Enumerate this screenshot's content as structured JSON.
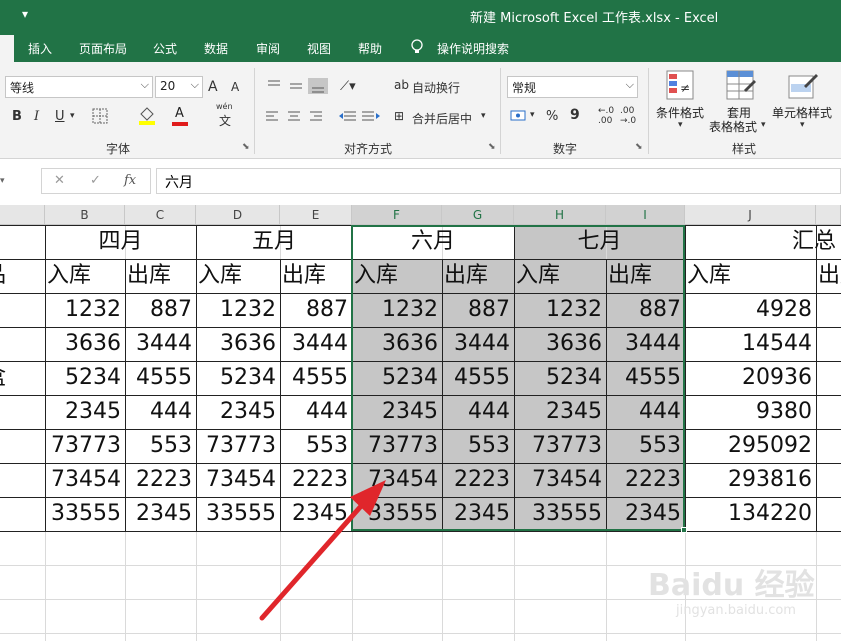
{
  "titlebar": {
    "qa_arrow": "▾",
    "title": "新建 Microsoft Excel 工作表.xlsx  -  Excel"
  },
  "menu": [
    "插入",
    "页面布局",
    "公式",
    "数据",
    "审阅",
    "视图",
    "帮助",
    "操作说明搜索"
  ],
  "ribbon": {
    "font_name": "等线",
    "font_size": "20",
    "grow_font": "A",
    "shrink_font": "A",
    "bold": "B",
    "italic": "I",
    "underline": "U",
    "font_color_glyph": "A",
    "wen_glyph": "wén",
    "wen_sub": "文",
    "wrap_text": "自动换行",
    "merge_center": "合并后居中",
    "number_format": "常规",
    "percent": "%",
    "comma": "9",
    "dec_inc": "←.0\n.00",
    "dec_dec": ".00\n→.0",
    "cond_format": "条件格式",
    "table_format_line1": "套用",
    "table_format_line2": "表格格式",
    "cell_styles": "单元格样式",
    "groups": {
      "font": "字体",
      "align": "对齐方式",
      "number": "数字",
      "styles": "样式"
    }
  },
  "formula_bar": {
    "cancel": "✕",
    "enter": "✓",
    "fx": "fx",
    "content": "六月"
  },
  "columns": [
    "B",
    "C",
    "D",
    "E",
    "F",
    "G",
    "H",
    "I",
    "J"
  ],
  "months": [
    "四月",
    "五月",
    "六月",
    "七月",
    "汇总"
  ],
  "subheaders": {
    "in": "入库",
    "out": "出库"
  },
  "row_labels": [
    "品",
    "",
    "",
    "盒",
    "",
    "",
    ""
  ],
  "rows": [
    [
      1232,
      887,
      1232,
      887,
      1232,
      887,
      1232,
      887,
      4928
    ],
    [
      3636,
      3444,
      3636,
      3444,
      3636,
      3444,
      3636,
      3444,
      14544
    ],
    [
      5234,
      4555,
      5234,
      4555,
      5234,
      4555,
      5234,
      4555,
      20936
    ],
    [
      2345,
      444,
      2345,
      444,
      2345,
      444,
      2345,
      444,
      9380
    ],
    [
      73773,
      553,
      73773,
      553,
      73773,
      553,
      73773,
      553,
      295092
    ],
    [
      73454,
      2223,
      73454,
      2223,
      73454,
      2223,
      73454,
      2223,
      293816
    ],
    [
      33555,
      2345,
      33555,
      2345,
      33555,
      2345,
      33555,
      2345,
      134220
    ]
  ],
  "watermark": {
    "main": "Baidu 经验",
    "sub": "jingyan.baidu.com"
  },
  "colors": {
    "excel_green": "#217346",
    "selection_fill": "#c6c6c6",
    "arrow": "#e0262b"
  }
}
